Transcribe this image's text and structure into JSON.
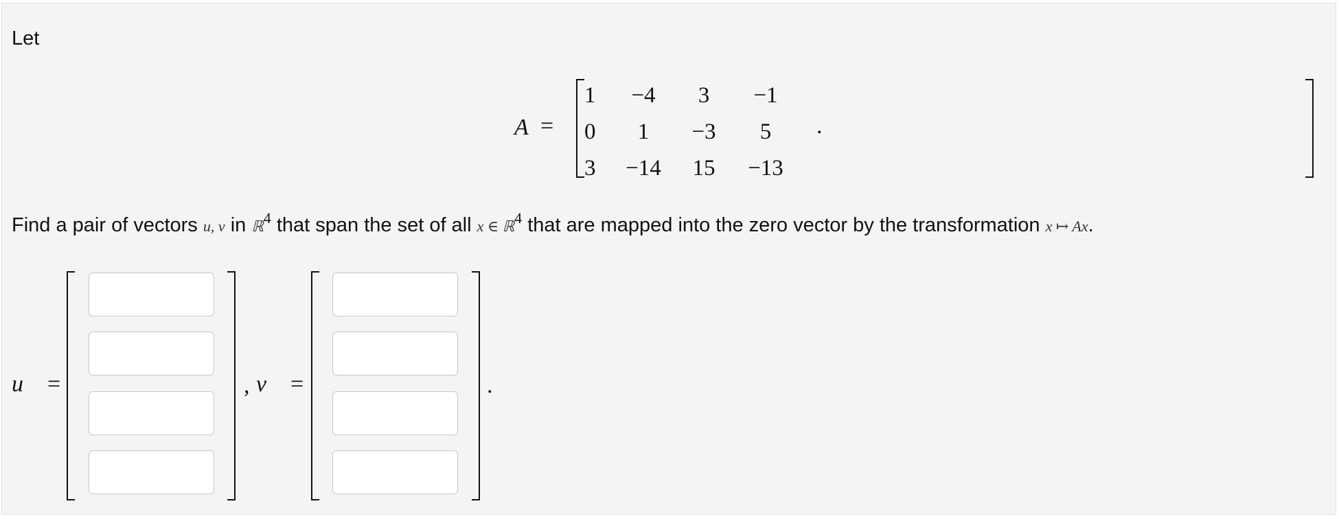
{
  "intro": "Let",
  "matrix": {
    "name": "A",
    "equals": "=",
    "rows": [
      [
        "1",
        "−4",
        "3",
        "−1"
      ],
      [
        "0",
        "1",
        "−3",
        "5"
      ],
      [
        "3",
        "−14",
        "15",
        "−13"
      ]
    ],
    "trailing": "."
  },
  "question": {
    "part1": "Find a pair of vectors",
    "sym_uv": "u, v",
    "part2": "in",
    "sym_R1": "ℝ",
    "exp1": "4",
    "part3": "that span the set of all",
    "sym_xin": "x ∈ ℝ",
    "exp2": "4",
    "part4": "that are mapped into the zero vector by the transformation",
    "sym_map": "x ↦ Ax",
    "end": "."
  },
  "vectors": {
    "u_label": "u⃗",
    "v_label": "v⃗",
    "equals": "=",
    "separator": ",",
    "trailing": ".",
    "u_values": [
      "",
      "",
      "",
      ""
    ],
    "v_values": [
      "",
      "",
      "",
      ""
    ]
  }
}
